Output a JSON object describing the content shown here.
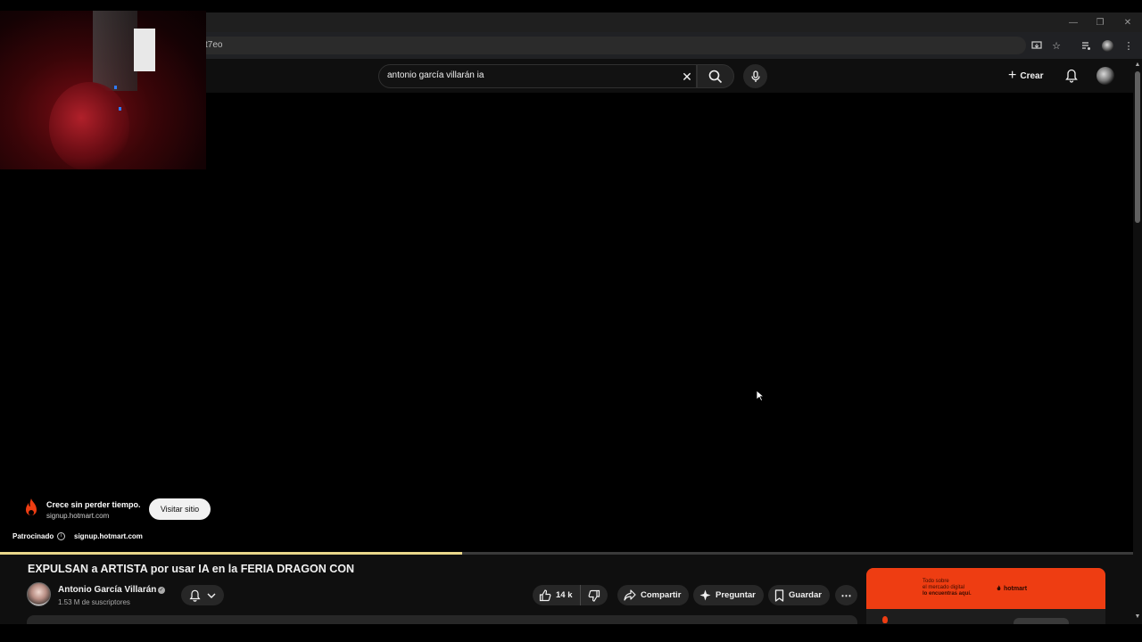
{
  "browser": {
    "url_fragment": "t7eo",
    "window_controls": [
      "minimize-icon",
      "restore-icon",
      "close-icon"
    ],
    "toolbar_icons": [
      "install-app-icon",
      "bookmark-star-icon",
      "media-control-icon",
      "profile-icon",
      "menu-kebab-icon"
    ]
  },
  "header": {
    "search_query": "antonio garcía villarán ia",
    "create_label": "Crear",
    "icons": [
      "clear-icon",
      "search-icon",
      "mic-icon",
      "bell-icon",
      "avatar"
    ]
  },
  "ad_overlay": {
    "title": "Crece sin perder tiempo.",
    "url": "signup.hotmart.com",
    "cta": "Visitar sitio",
    "sponsored_label": "Patrocinado",
    "domain": "signup.hotmart.com"
  },
  "player": {
    "progress_fraction": 0.405
  },
  "video": {
    "title": "EXPULSAN a ARTISTA por usar IA en la FERIA DRAGON CON",
    "channel_name": "Antonio García Villarán",
    "subscribers": "1.53 M de suscriptores",
    "likes": "14 k",
    "share_label": "Compartir",
    "ask_label": "Preguntar",
    "save_label": "Guardar"
  },
  "side_ad": {
    "banner_line1": "Todo sobre",
    "banner_line2": "el mercado digital",
    "banner_line3": "lo encuentras aquí.",
    "brand": "hotmart"
  },
  "colors": {
    "background": "#0f0f0f",
    "progress": "#e9d68a",
    "hotmart": "#ee3d12",
    "pill": "#272727"
  }
}
